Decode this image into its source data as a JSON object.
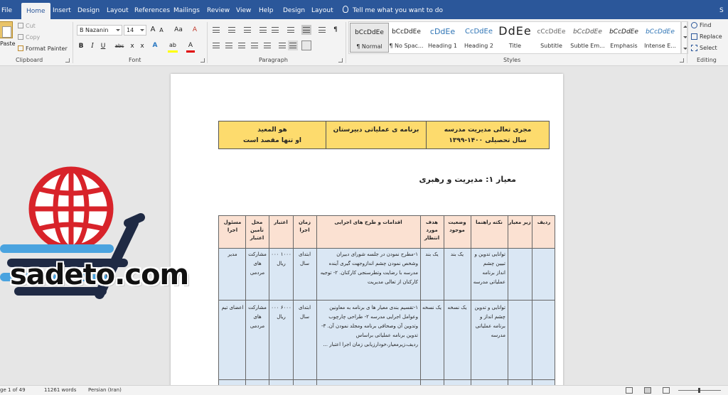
{
  "tabs": [
    {
      "label": "File",
      "active": false
    },
    {
      "label": "Home",
      "active": true
    },
    {
      "label": "Insert",
      "active": false
    },
    {
      "label": "Design",
      "active": false
    },
    {
      "label": "Layout",
      "active": false
    },
    {
      "label": "References",
      "active": false
    },
    {
      "label": "Mailings",
      "active": false
    },
    {
      "label": "Review",
      "active": false
    },
    {
      "label": "View",
      "active": false
    },
    {
      "label": "Help",
      "active": false
    },
    {
      "label": "Design",
      "active": false
    },
    {
      "label": "Layout",
      "active": false
    }
  ],
  "tell_me": "Tell me what you want to do",
  "share": "S",
  "clipboard": {
    "paste": "Paste",
    "cut": "Cut",
    "copy": "Copy",
    "format_painter": "Format Painter",
    "label": "Clipboard"
  },
  "font": {
    "name": "B Nazanin",
    "size": "14",
    "label": "Font",
    "case_btn": "Aa",
    "bold": "B",
    "italic": "I",
    "underline": "U",
    "strike": "abc",
    "subscript": "x",
    "superscript": "x",
    "text_effects": "A",
    "highlight": "ab",
    "font_color": "A",
    "grow": "A",
    "shrink": "A",
    "clear": "A",
    "highlight_color": "#ffff00",
    "font_color_value": "#e00000"
  },
  "paragraph": {
    "label": "Paragraph",
    "pilcrow": "¶"
  },
  "styles": {
    "label": "Styles",
    "items": [
      {
        "sample": "bCcDdEe",
        "name": "¶ Normal"
      },
      {
        "sample": "bCcDdEe",
        "name": "¶ No Spac..."
      },
      {
        "sample": "cDdEe",
        "name": "Heading 1"
      },
      {
        "sample": "CcDdEe",
        "name": "Heading 2"
      },
      {
        "sample": "DdEe",
        "name": "Title"
      },
      {
        "sample": "cCcDdEe",
        "name": "Subtitle"
      },
      {
        "sample": "bCcDdEe",
        "name": "Subtle Em..."
      },
      {
        "sample": "bCcDdEe",
        "name": "Emphasis"
      },
      {
        "sample": "bCcDdEe",
        "name": "Intense E..."
      }
    ]
  },
  "editing": {
    "label": "Editing",
    "find": "Find",
    "replace": "Replace",
    "select": "Select"
  },
  "document": {
    "header_table": {
      "right_line1": "مجری تعالی مدیریت مدرسه",
      "right_line2": "سال تحصیلی ۱۴۰۰-۱۳۹۹",
      "middle": "برنامه ی عملیاتی دبیرستان",
      "left_line1": "هو المعید",
      "left_line2": "او تنها مقصد است"
    },
    "criterion": "معیار ۱: مدیریت و رهبری",
    "table": {
      "headers": [
        "ردیف",
        "زیر معیار",
        "نکته راهنما",
        "وضعیت موجود",
        "هدف مورد انتظار",
        "اقدامات و طرح های اجرایی",
        "زمان اجرا",
        "اعتبار",
        "محل تأمین اعتبار",
        "مسئول اجرا"
      ],
      "rows": [
        {
          "guide": "توانایی تدوین و تبیین چشم انداز برنامه عملیاتی مدرسه",
          "status": "یک بند",
          "target": "یک بند",
          "actions": "۱-مطرح نمودن در جلسه شورای دبیران وشخص نمودن چشم اندازوجهت گیری آینده مدرسه با رضایت وتطرسنجی کارکنان. ۲- توجیه کارکنان از تعالی مدیریت",
          "time": "ابتدای سال",
          "budget": "۱۰۰۰ ۰۰۰ ریال",
          "source": "مشارکت های مردمی",
          "owner": "مدیر"
        },
        {
          "guide": "توانایی و تدوین چشم انداز و برنامه عملیاتی مدرسه",
          "status": "یک نسخه",
          "target": "یک نسخه",
          "actions": "۱-تقسیم بندی معیار ها ی برنامه به معاونین وعوامل اجرایی مدرسه ۲- طراحی چارچوب وتدوین آن وصحافی برنامه ومجلد نمودن آن. ۳- تدوین برنامه عملیاتی براساس ردیف،زیرمعیار،خودارزیابی زمان اجرا اعتبار ...",
          "time": "ابتدای سال",
          "budget": "۶۰۰۰ ۰۰۰ ریال",
          "source": "مشارکت های مردمی",
          "owner": "اعضای تیم"
        }
      ]
    }
  },
  "logo": {
    "text": "sadeto.com"
  },
  "status": {
    "page": "ge 1 of 49",
    "words": "11261 words",
    "language": "Persian (Iran)"
  },
  "colors": {
    "accent": "#2b579a",
    "header_table": "#fddb6d",
    "table_head": "#fbe1d2",
    "table_body": "#dae7f4",
    "logo_red": "#d8232a",
    "logo_navy": "#1f2a44",
    "logo_blue": "#4aa3df"
  }
}
